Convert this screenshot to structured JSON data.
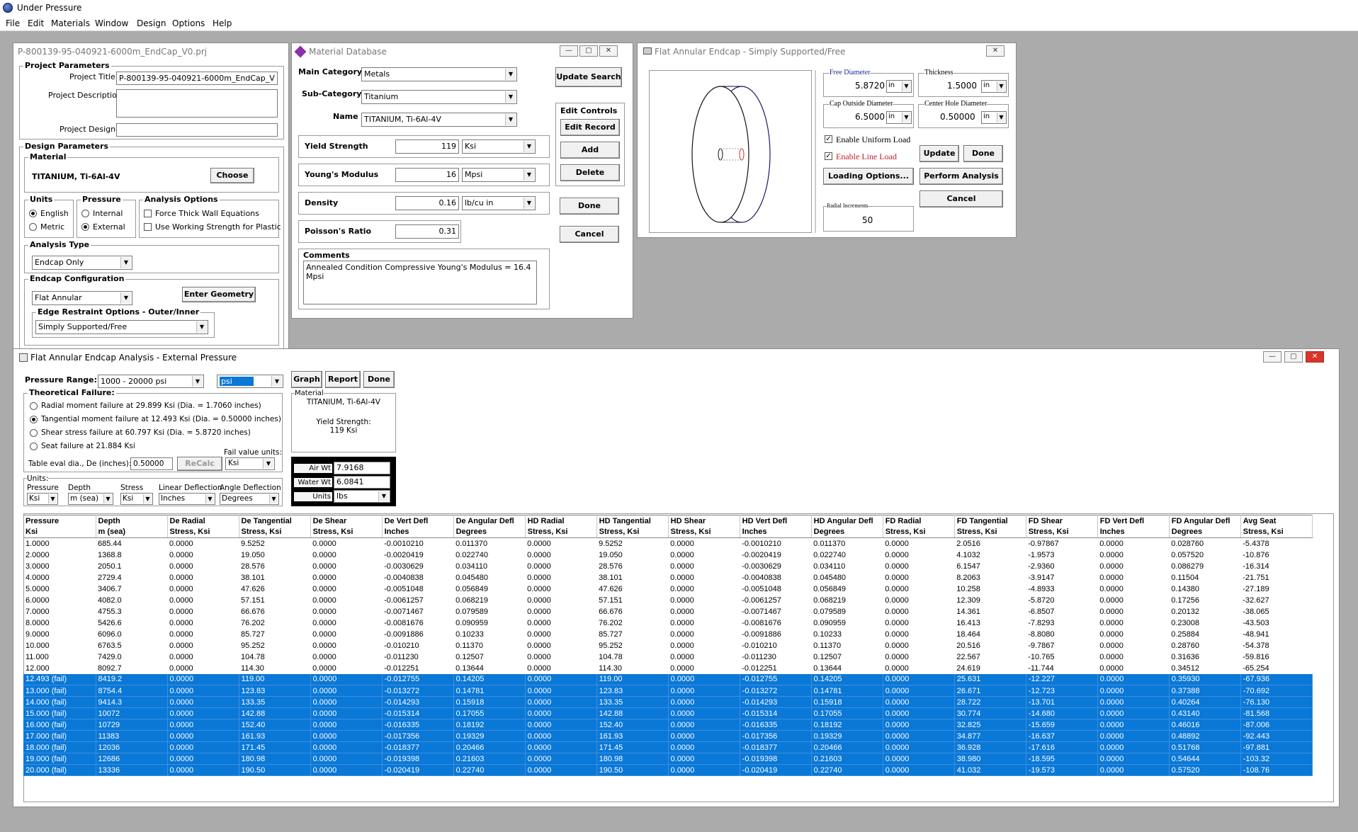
{
  "app": {
    "title": "Under Pressure"
  },
  "menu": [
    "File",
    "Edit",
    "Materials",
    "Window",
    "Design",
    "Options",
    "Help"
  ],
  "project_window": {
    "title": "P-800139-95-040921-6000m_EndCap_V0.prj",
    "project_params_label": "Project Parameters",
    "project_title_label": "Project Title",
    "project_title_value": "P-800139-95-040921-6000m_EndCap_V",
    "project_description_label": "Project Description",
    "project_designer_label": "Project Designer",
    "design_params_label": "Design Parameters",
    "material_label": "Material",
    "material_value": "TITANIUM, Ti-6Al-4V",
    "choose_label": "Choose",
    "units_label": "Units",
    "units_english": "English",
    "units_metric": "Metric",
    "pressure_label": "Pressure",
    "pressure_internal": "Internal",
    "pressure_external": "External",
    "analysis_options_label": "Analysis Options",
    "force_thick_wall": "Force Thick Wall Equations",
    "use_working_strength": "Use Working Strength for Plastic",
    "analysis_type_label": "Analysis Type",
    "analysis_type_value": "Endcap Only",
    "endcap_config_label": "Endcap Configuration",
    "endcap_config_value": "Flat Annular",
    "enter_geometry_label": "Enter Geometry",
    "edge_restraint_label": "Edge Restraint Options - Outer/Inner",
    "edge_restraint_value": "Simply Supported/Free"
  },
  "material_window": {
    "title": "Material Database",
    "main_category_label": "Main Category",
    "main_category_value": "Metals",
    "sub_category_label": "Sub-Category",
    "sub_category_value": "Titanium",
    "name_label": "Name",
    "name_value": "TITANIUM, Ti-6Al-4V",
    "yield_label": "Yield Strength",
    "yield_value": "119",
    "yield_unit": "Ksi",
    "youngs_label": "Young's Modulus",
    "youngs_value": "16",
    "youngs_unit": "Mpsi",
    "density_label": "Density",
    "density_value": "0.16",
    "density_unit": "lb/cu in",
    "poisson_label": "Poisson's Ratio",
    "poisson_value": "0.31",
    "comments_label": "Comments",
    "comments_value": "Annealed Condition  Compressive Young's Modulus = 16.4 Mpsi",
    "update_search_label": "Update Search",
    "edit_controls_label": "Edit Controls",
    "edit_record_label": "Edit Record",
    "add_label": "Add",
    "delete_label": "Delete",
    "done_label": "Done",
    "cancel_label": "Cancel"
  },
  "endcap_window": {
    "title": "Flat Annular Endcap - Simply Supported/Free",
    "free_diameter_label": "Free Diameter",
    "free_diameter_value": "5.8720",
    "free_diameter_unit": "in",
    "thickness_label": "Thickness",
    "thickness_value": "1.5000",
    "thickness_unit": "in",
    "cap_outside_label": "Cap Outside Diameter",
    "cap_outside_value": "6.5000",
    "cap_outside_unit": "in",
    "center_hole_label": "Center Hole Diameter",
    "center_hole_value": "0.50000",
    "center_hole_unit": "in",
    "enable_uniform_label": "Enable Uniform Load",
    "enable_line_label": "Enable Line Load",
    "update_label": "Update",
    "done_label": "Done",
    "loading_options_label": "Loading Options...",
    "perform_analysis_label": "Perform Analysis",
    "cancel_label": "Cancel",
    "radial_increments_label": "Radial Increments",
    "radial_increments_value": "50"
  },
  "analysis_window": {
    "title": "Flat Annular Endcap Analysis - External Pressure",
    "pressure_range_label": "Pressure Range:",
    "pressure_range_value": "1000 - 20000 psi",
    "unit_value": "psi",
    "graph_label": "Graph",
    "report_label": "Report",
    "done_label": "Done",
    "theoretical_failure_label": "Theoretical Failure:",
    "failures": [
      "Radial moment failure at 29.899 Ksi (Dia. = 1.7060 inches)",
      "Tangential moment failure at 12.493 Ksi (Dia. = 0.50000 inches)",
      "Shear stress failure at 60.797 Ksi (Dia. = 5.8720 inches)",
      "Seat failure at 21.884 Ksi"
    ],
    "fail_value_units_label": "Fail value units:",
    "fail_value_units_value": "Ksi",
    "table_eval_label": "Table eval dia., De (inches):",
    "table_eval_value": "0.50000",
    "recalc_label": "ReCalc",
    "material_box_label": "Material",
    "material_box_value": "TITANIUM, Ti-6Al-4V",
    "yield_box_label": "Yield Strength:",
    "yield_box_value": "119 Ksi",
    "air_wt_label": "Air Wt",
    "air_wt_value": "7.9168",
    "water_wt_label": "Water Wt",
    "water_wt_value": "6.0841",
    "wt_units_label": "Units",
    "wt_units_value": "lbs",
    "units_group_label": "Units:",
    "unit_pressure_label": "Pressure",
    "unit_pressure_value": "Ksi",
    "unit_depth_label": "Depth",
    "unit_depth_value": "m (sea)",
    "unit_stress_label": "Stress",
    "unit_stress_value": "Ksi",
    "unit_lindef_label": "Linear Deflection",
    "unit_lindef_value": "Inches",
    "unit_angdef_label": "Angle Deflection",
    "unit_angdef_value": "Degrees"
  },
  "table": {
    "header1": [
      "Pressure",
      "Depth",
      "De Radial",
      "De Tangential",
      "De Shear",
      "De Vert Defl",
      "De Angular Defl",
      "HD Radial",
      "HD Tangential",
      "HD Shear",
      "HD Vert Defl",
      "HD Angular Defl",
      "FD Radial",
      "FD Tangential",
      "FD Shear",
      "FD Vert Defl",
      "FD Angular Defl",
      "Avg Seat"
    ],
    "header2": [
      "Ksi",
      "m (sea)",
      "Stress, Ksi",
      "Stress, Ksi",
      "Stress, Ksi",
      "Inches",
      "Degrees",
      "Stress, Ksi",
      "Stress, Ksi",
      "Stress, Ksi",
      "Inches",
      "Degrees",
      "Stress, Ksi",
      "Stress, Ksi",
      "Stress, Ksi",
      "Inches",
      "Degrees",
      "Stress, Ksi"
    ],
    "rows": [
      {
        "fail": false,
        "cells": [
          "1.0000",
          "685.44",
          "0.0000",
          "9.5252",
          "0.0000",
          "-0.0010210",
          "0.011370",
          "0.0000",
          "9.5252",
          "0.0000",
          "-0.0010210",
          "0.011370",
          "0.0000",
          "2.0516",
          "-0.97867",
          "0.0000",
          "0.028760",
          "-5.4378"
        ]
      },
      {
        "fail": false,
        "cells": [
          "2.0000",
          "1368.8",
          "0.0000",
          "19.050",
          "0.0000",
          "-0.0020419",
          "0.022740",
          "0.0000",
          "19.050",
          "0.0000",
          "-0.0020419",
          "0.022740",
          "0.0000",
          "4.1032",
          "-1.9573",
          "0.0000",
          "0.057520",
          "-10.876"
        ]
      },
      {
        "fail": false,
        "cells": [
          "3.0000",
          "2050.1",
          "0.0000",
          "28.576",
          "0.0000",
          "-0.0030629",
          "0.034110",
          "0.0000",
          "28.576",
          "0.0000",
          "-0.0030629",
          "0.034110",
          "0.0000",
          "6.1547",
          "-2.9360",
          "0.0000",
          "0.086279",
          "-16.314"
        ]
      },
      {
        "fail": false,
        "cells": [
          "4.0000",
          "2729.4",
          "0.0000",
          "38.101",
          "0.0000",
          "-0.0040838",
          "0.045480",
          "0.0000",
          "38.101",
          "0.0000",
          "-0.0040838",
          "0.045480",
          "0.0000",
          "8.2063",
          "-3.9147",
          "0.0000",
          "0.11504",
          "-21.751"
        ]
      },
      {
        "fail": false,
        "cells": [
          "5.0000",
          "3406.7",
          "0.0000",
          "47.626",
          "0.0000",
          "-0.0051048",
          "0.056849",
          "0.0000",
          "47.626",
          "0.0000",
          "-0.0051048",
          "0.056849",
          "0.0000",
          "10.258",
          "-4.8933",
          "0.0000",
          "0.14380",
          "-27.189"
        ]
      },
      {
        "fail": false,
        "cells": [
          "6.0000",
          "4082.0",
          "0.0000",
          "57.151",
          "0.0000",
          "-0.0061257",
          "0.068219",
          "0.0000",
          "57.151",
          "0.0000",
          "-0.0061257",
          "0.068219",
          "0.0000",
          "12.309",
          "-5.8720",
          "0.0000",
          "0.17256",
          "-32.627"
        ]
      },
      {
        "fail": false,
        "cells": [
          "7.0000",
          "4755.3",
          "0.0000",
          "66.676",
          "0.0000",
          "-0.0071467",
          "0.079589",
          "0.0000",
          "66.676",
          "0.0000",
          "-0.0071467",
          "0.079589",
          "0.0000",
          "14.361",
          "-6.8507",
          "0.0000",
          "0.20132",
          "-38.065"
        ]
      },
      {
        "fail": false,
        "cells": [
          "8.0000",
          "5426.6",
          "0.0000",
          "76.202",
          "0.0000",
          "-0.0081676",
          "0.090959",
          "0.0000",
          "76.202",
          "0.0000",
          "-0.0081676",
          "0.090959",
          "0.0000",
          "16.413",
          "-7.8293",
          "0.0000",
          "0.23008",
          "-43.503"
        ]
      },
      {
        "fail": false,
        "cells": [
          "9.0000",
          "6096.0",
          "0.0000",
          "85.727",
          "0.0000",
          "-0.0091886",
          "0.10233",
          "0.0000",
          "85.727",
          "0.0000",
          "-0.0091886",
          "0.10233",
          "0.0000",
          "18.464",
          "-8.8080",
          "0.0000",
          "0.25884",
          "-48.941"
        ]
      },
      {
        "fail": false,
        "cells": [
          "10.000",
          "6763.5",
          "0.0000",
          "95.252",
          "0.0000",
          "-0.010210",
          "0.11370",
          "0.0000",
          "95.252",
          "0.0000",
          "-0.010210",
          "0.11370",
          "0.0000",
          "20.516",
          "-9.7867",
          "0.0000",
          "0.28760",
          "-54.378"
        ]
      },
      {
        "fail": false,
        "cells": [
          "11.000",
          "7429.0",
          "0.0000",
          "104.78",
          "0.0000",
          "-0.011230",
          "0.12507",
          "0.0000",
          "104.78",
          "0.0000",
          "-0.011230",
          "0.12507",
          "0.0000",
          "22.567",
          "-10.765",
          "0.0000",
          "0.31636",
          "-59.816"
        ]
      },
      {
        "fail": false,
        "cells": [
          "12.000",
          "8092.7",
          "0.0000",
          "114.30",
          "0.0000",
          "-0.012251",
          "0.13644",
          "0.0000",
          "114.30",
          "0.0000",
          "-0.012251",
          "0.13644",
          "0.0000",
          "24.619",
          "-11.744",
          "0.0000",
          "0.34512",
          "-65.254"
        ]
      },
      {
        "fail": true,
        "cells": [
          "12.493 (fail)",
          "8419.2",
          "0.0000",
          "119.00",
          "0.0000",
          "-0.012755",
          "0.14205",
          "0.0000",
          "119.00",
          "0.0000",
          "-0.012755",
          "0.14205",
          "0.0000",
          "25.631",
          "-12.227",
          "0.0000",
          "0.35930",
          "-67.936"
        ]
      },
      {
        "fail": true,
        "cells": [
          "13.000 (fail)",
          "8754.4",
          "0.0000",
          "123.83",
          "0.0000",
          "-0.013272",
          "0.14781",
          "0.0000",
          "123.83",
          "0.0000",
          "-0.013272",
          "0.14781",
          "0.0000",
          "26.671",
          "-12.723",
          "0.0000",
          "0.37388",
          "-70.692"
        ]
      },
      {
        "fail": true,
        "cells": [
          "14.000 (fail)",
          "9414.3",
          "0.0000",
          "133.35",
          "0.0000",
          "-0.014293",
          "0.15918",
          "0.0000",
          "133.35",
          "0.0000",
          "-0.014293",
          "0.15918",
          "0.0000",
          "28.722",
          "-13.701",
          "0.0000",
          "0.40264",
          "-76.130"
        ]
      },
      {
        "fail": true,
        "cells": [
          "15.000 (fail)",
          "10072",
          "0.0000",
          "142.88",
          "0.0000",
          "-0.015314",
          "0.17055",
          "0.0000",
          "142.88",
          "0.0000",
          "-0.015314",
          "0.17055",
          "0.0000",
          "30.774",
          "-14.680",
          "0.0000",
          "0.43140",
          "-81.568"
        ]
      },
      {
        "fail": true,
        "cells": [
          "16.000 (fail)",
          "10729",
          "0.0000",
          "152.40",
          "0.0000",
          "-0.016335",
          "0.18192",
          "0.0000",
          "152.40",
          "0.0000",
          "-0.016335",
          "0.18192",
          "0.0000",
          "32.825",
          "-15.659",
          "0.0000",
          "0.46016",
          "-87.006"
        ]
      },
      {
        "fail": true,
        "cells": [
          "17.000 (fail)",
          "11383",
          "0.0000",
          "161.93",
          "0.0000",
          "-0.017356",
          "0.19329",
          "0.0000",
          "161.93",
          "0.0000",
          "-0.017356",
          "0.19329",
          "0.0000",
          "34.877",
          "-16.637",
          "0.0000",
          "0.48892",
          "-92.443"
        ]
      },
      {
        "fail": true,
        "cells": [
          "18.000 (fail)",
          "12036",
          "0.0000",
          "171.45",
          "0.0000",
          "-0.018377",
          "0.20466",
          "0.0000",
          "171.45",
          "0.0000",
          "-0.018377",
          "0.20466",
          "0.0000",
          "36.928",
          "-17.616",
          "0.0000",
          "0.51768",
          "-97.881"
        ]
      },
      {
        "fail": true,
        "cells": [
          "19.000 (fail)",
          "12686",
          "0.0000",
          "180.98",
          "0.0000",
          "-0.019398",
          "0.21603",
          "0.0000",
          "180.98",
          "0.0000",
          "-0.019398",
          "0.21603",
          "0.0000",
          "38.980",
          "-18.595",
          "0.0000",
          "0.54644",
          "-103.32"
        ]
      },
      {
        "fail": true,
        "cells": [
          "20.000 (fail)",
          "13336",
          "0.0000",
          "190.50",
          "0.0000",
          "-0.020419",
          "0.22740",
          "0.0000",
          "190.50",
          "0.0000",
          "-0.020419",
          "0.22740",
          "0.0000",
          "41.032",
          "-19.573",
          "0.0000",
          "0.57520",
          "-108.76"
        ]
      }
    ]
  }
}
